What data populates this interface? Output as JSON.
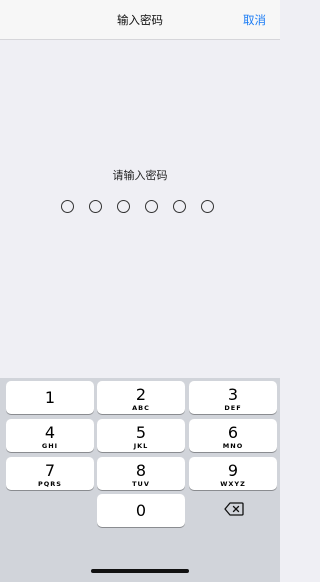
{
  "navbar": {
    "title": "输入密码",
    "cancel_label": "取消"
  },
  "prompt": "请输入密码",
  "passcode": {
    "length": 6,
    "entered": 0
  },
  "keypad": {
    "keys": [
      {
        "num": "1",
        "letters": ""
      },
      {
        "num": "2",
        "letters": "ABC"
      },
      {
        "num": "3",
        "letters": "DEF"
      },
      {
        "num": "4",
        "letters": "GHI"
      },
      {
        "num": "5",
        "letters": "JKL"
      },
      {
        "num": "6",
        "letters": "MNO"
      },
      {
        "num": "7",
        "letters": "PQRS"
      },
      {
        "num": "8",
        "letters": "TUV"
      },
      {
        "num": "9",
        "letters": "WXYZ"
      },
      {
        "num": "0",
        "letters": ""
      }
    ],
    "delete_icon": "backspace-icon"
  },
  "colors": {
    "accent": "#1a7cf5",
    "background": "#efeff4",
    "keyboard_background": "#d1d4da"
  }
}
